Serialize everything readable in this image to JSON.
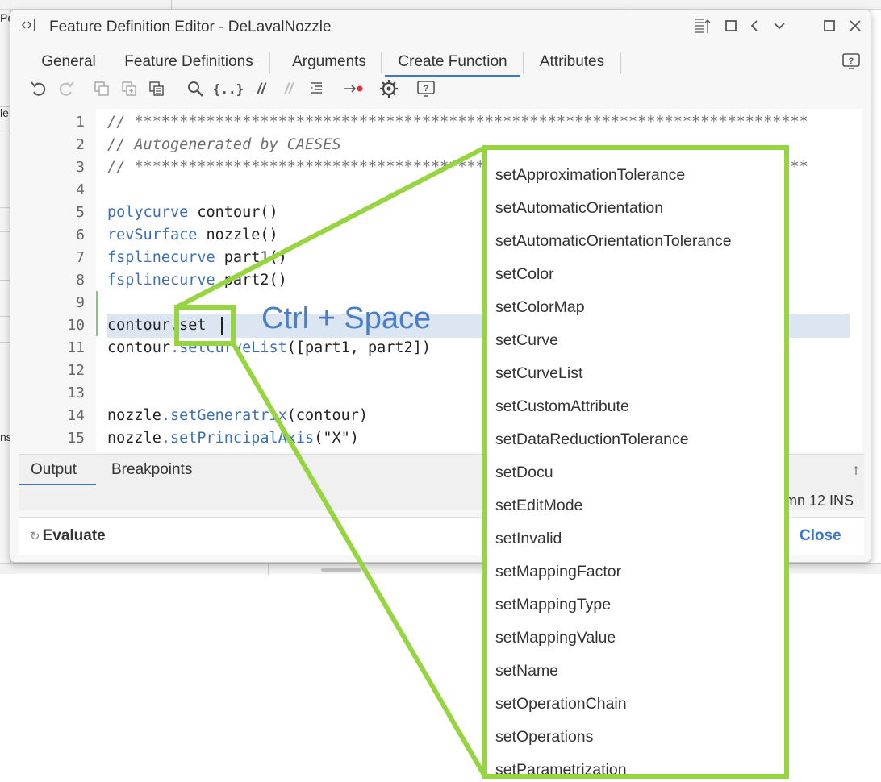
{
  "window": {
    "title": "Feature Definition Editor - DeLavalNozzle"
  },
  "tabs": [
    {
      "label": "General"
    },
    {
      "label": "Feature Definitions"
    },
    {
      "label": "Arguments"
    },
    {
      "label": "Create Function",
      "active": true
    },
    {
      "label": "Attributes"
    }
  ],
  "toolbar": {
    "icons": [
      "undo-icon",
      "redo-icon",
      "copy-icon",
      "duplicate-icon",
      "paste-icon",
      "search-icon",
      "snippet-icon",
      "comment-icon",
      "uncomment-icon",
      "indent-icon",
      "breakpoint-icon",
      "settings-icon",
      "help-icon"
    ],
    "snippet_glyph": "{..}",
    "comment_glyph": "//",
    "uncomment_glyph": "//"
  },
  "editor": {
    "lines": [
      {
        "n": "1",
        "text": "// ***************************************************************************"
      },
      {
        "n": "2",
        "text": "// Autogenerated by CAESES"
      },
      {
        "n": "3",
        "text": "// ***************************************************************************"
      },
      {
        "n": "4",
        "text": ""
      },
      {
        "n": "5",
        "kw": "polycurve",
        "rest": " contour()"
      },
      {
        "n": "6",
        "kw": "revSurface",
        "rest": " nozzle()"
      },
      {
        "n": "7",
        "kw": "fsplinecurve",
        "rest": " part1()"
      },
      {
        "n": "8",
        "kw": "fsplinecurve",
        "rest": " part2()"
      },
      {
        "n": "9",
        "text": ""
      },
      {
        "n": "10",
        "obj": "contour",
        "dot": ".",
        "call": "set",
        "tail": ""
      },
      {
        "n": "11",
        "obj": "contour",
        "dot": ".",
        "call": "setCurveList",
        "tail": "([part1, part2])"
      },
      {
        "n": "12",
        "text": ""
      },
      {
        "n": "13",
        "text": ""
      },
      {
        "n": "14",
        "obj": "nozzle",
        "dot": ".",
        "call": "setGeneratrix",
        "tail": "(contour)"
      },
      {
        "n": "15",
        "obj": "nozzle",
        "dot": ".",
        "call": "setPrincipalAxis",
        "tail": "(\"X\")"
      }
    ]
  },
  "bottom_tabs": [
    {
      "label": "Output",
      "active": true
    },
    {
      "label": "Breakpoints"
    }
  ],
  "status": {
    "cursor": "mn 12 INS"
  },
  "footer": {
    "evaluate_label": "Evaluate",
    "evaluate_glyph": "↻",
    "close_label": "Close"
  },
  "annotation": {
    "shortcut": "Ctrl + Space",
    "accent": "#97d540"
  },
  "completion": {
    "items": [
      "setApproximationTolerance",
      "setAutomaticOrientation",
      "setAutomaticOrientationTolerance",
      "setColor",
      "setColorMap",
      "setCurve",
      "setCurveList",
      "setCustomAttribute",
      "setDataReductionTolerance",
      "setDocu",
      "setEditMode",
      "setInvalid",
      "setMappingFactor",
      "setMappingType",
      "setMappingValue",
      "setName",
      "setOperationChain",
      "setOperations",
      "setParametrization"
    ]
  },
  "background": {
    "left_glyphs": [
      "Pe",
      "le",
      "ns"
    ]
  }
}
